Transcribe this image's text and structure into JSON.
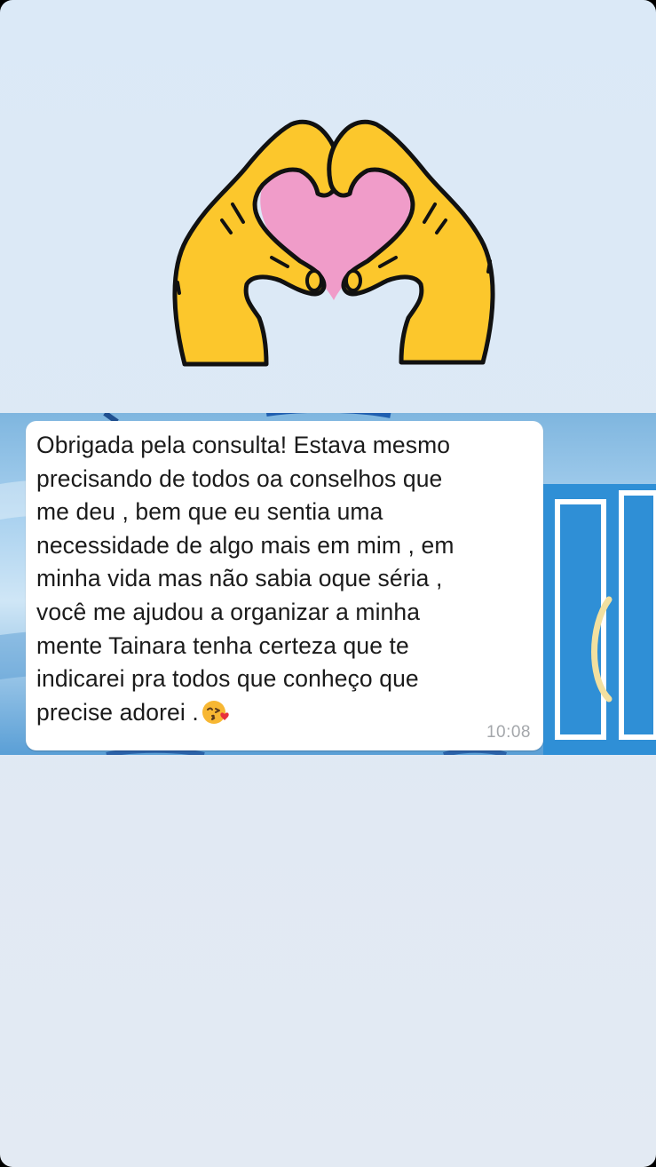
{
  "message": {
    "lines": [
      "Obrigada pela consulta! Estava mesmo",
      "precisando de todos oa conselhos que",
      "me deu , bem que eu sentia uma",
      "necessidade de algo mais em mim , em",
      "minha vida mas não sabia oque séria ,",
      "você me ajudou a organizar a minha",
      "mente Tainara tenha certeza que te",
      "indicarei pra todos que conheço que",
      "precise adorei ."
    ],
    "emoji": "kissing-heart-emoji",
    "time": "10:08"
  },
  "sticker": {
    "icon": "heart-hands-icon",
    "colors": {
      "hands": "#fcc72c",
      "heart": "#f09cc9",
      "outline": "#111111"
    }
  },
  "colors": {
    "background": "#dde9f5",
    "bubble": "#ffffff",
    "text": "#1b1b1b",
    "time": "#a4a7ab"
  }
}
